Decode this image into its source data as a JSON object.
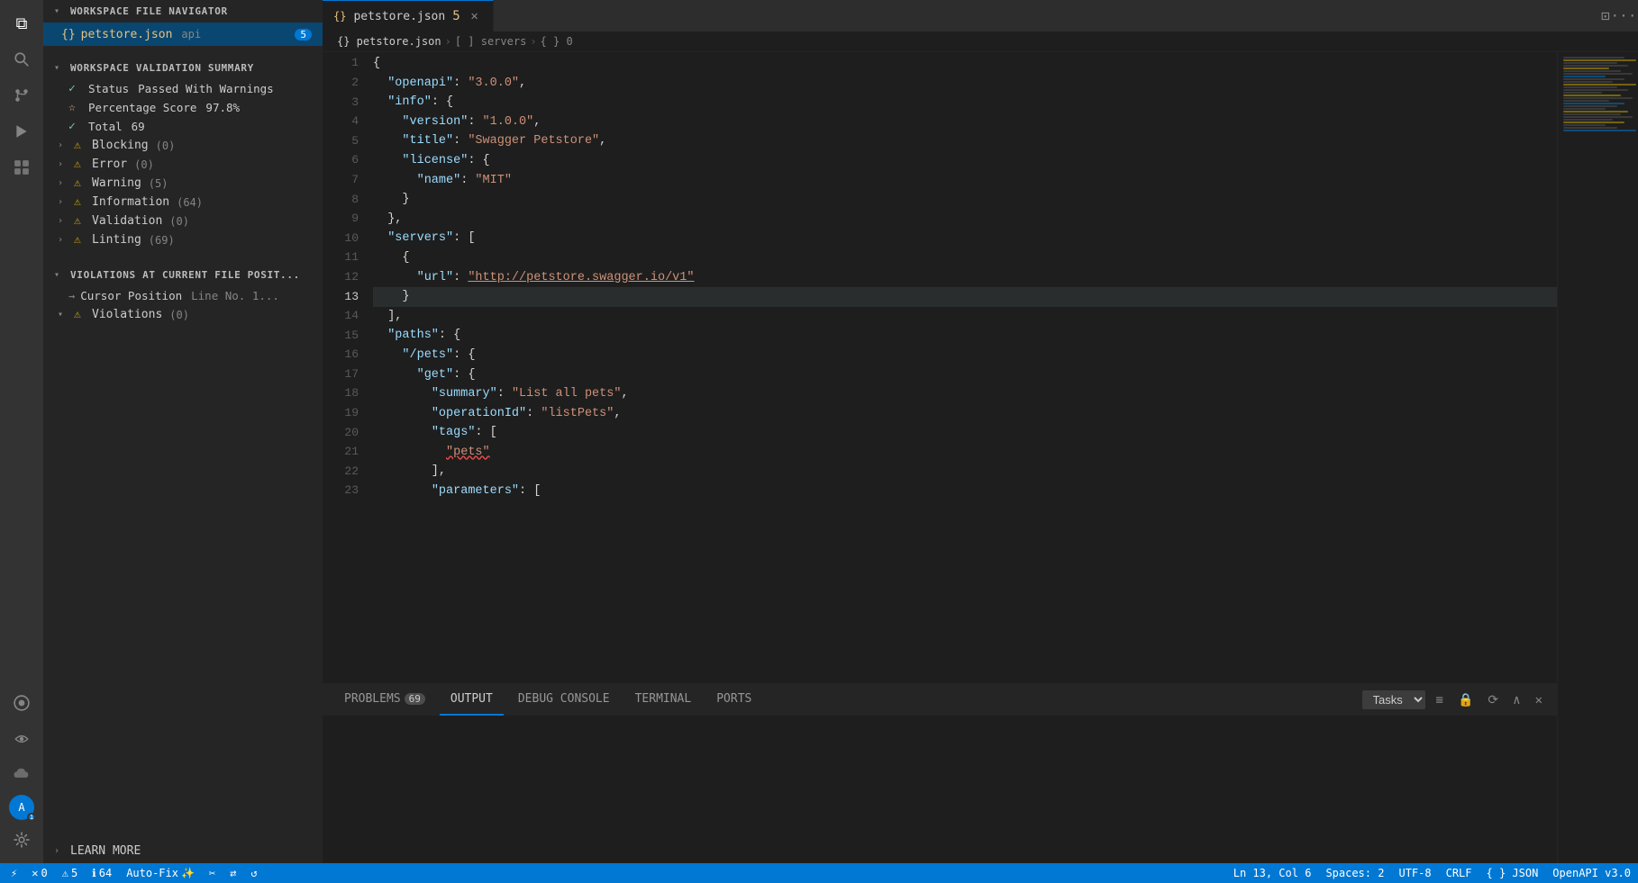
{
  "activityBar": {
    "icons": [
      {
        "name": "files-icon",
        "symbol": "⧉",
        "active": true
      },
      {
        "name": "search-icon",
        "symbol": "🔍"
      },
      {
        "name": "source-control-icon",
        "symbol": "⑂"
      },
      {
        "name": "run-debug-icon",
        "symbol": "▷"
      },
      {
        "name": "extensions-icon",
        "symbol": "⧉"
      },
      {
        "name": "github-icon",
        "symbol": "●"
      },
      {
        "name": "remote-icon",
        "symbol": "☁"
      },
      {
        "name": "cloud-icon",
        "symbol": "☁"
      }
    ]
  },
  "sidebar": {
    "workspaceNavigator": {
      "label": "WORKSPACE FILE NAVIGATOR",
      "file": {
        "icon": "{}",
        "name": "petstore.json",
        "desc": "api",
        "badge": "5"
      }
    },
    "validationSummary": {
      "label": "WORKSPACE VALIDATION SUMMARY",
      "items": [
        {
          "type": "status",
          "icon": "✓",
          "label": "Status",
          "value": "Passed With Warnings"
        },
        {
          "type": "star",
          "icon": "☆",
          "label": "Percentage Score",
          "value": "97.8%"
        },
        {
          "type": "check",
          "icon": "✓",
          "label": "Total",
          "value": "69"
        }
      ],
      "violations": [
        {
          "label": "Blocking",
          "count": "(0)"
        },
        {
          "label": "Error",
          "count": "(0)"
        },
        {
          "label": "Warning",
          "count": "(5)"
        },
        {
          "label": "Information",
          "count": "(64)"
        },
        {
          "label": "Validation",
          "count": "(0)"
        },
        {
          "label": "Linting",
          "count": "(69)"
        }
      ]
    },
    "violationsSection": {
      "label": "VIOLATIONS AT CURRENT FILE POSIT...",
      "cursorPosition": {
        "label": "Cursor Position",
        "value": "Line No. 1..."
      },
      "violations": {
        "label": "Violations",
        "count": "(0)"
      }
    },
    "learnMore": {
      "label": "LEARN MORE"
    }
  },
  "editor": {
    "tab": {
      "icon": "{}",
      "name": "petstore.json",
      "modified": "5",
      "closable": true
    },
    "breadcrumb": {
      "file": "petstore.json",
      "path1": "[ ] servers",
      "path2": "{ } 0"
    },
    "lines": [
      {
        "num": 1,
        "content": "{"
      },
      {
        "num": 2,
        "content": "  \"openapi\": \"3.0.0\","
      },
      {
        "num": 3,
        "content": "  \"info\": {"
      },
      {
        "num": 4,
        "content": "    \"version\": \"1.0.0\","
      },
      {
        "num": 5,
        "content": "    \"title\": \"Swagger Petstore\","
      },
      {
        "num": 6,
        "content": "    \"license\": {"
      },
      {
        "num": 7,
        "content": "      \"name\": \"MIT\""
      },
      {
        "num": 8,
        "content": "    }"
      },
      {
        "num": 9,
        "content": "  },"
      },
      {
        "num": 10,
        "content": "  \"servers\": ["
      },
      {
        "num": 11,
        "content": "    {"
      },
      {
        "num": 12,
        "content": "      \"url\": \"http://petstore.swagger.io/v1\""
      },
      {
        "num": 13,
        "content": "    }"
      },
      {
        "num": 14,
        "content": "  ],"
      },
      {
        "num": 15,
        "content": "  \"paths\": {"
      },
      {
        "num": 16,
        "content": "    \"/pets\": {"
      },
      {
        "num": 17,
        "content": "      \"get\": {"
      },
      {
        "num": 18,
        "content": "        \"summary\": \"List all pets\","
      },
      {
        "num": 19,
        "content": "        \"operationId\": \"listPets\","
      },
      {
        "num": 20,
        "content": "        \"tags\": ["
      },
      {
        "num": 21,
        "content": "          \"pets\""
      },
      {
        "num": 22,
        "content": "        ],"
      },
      {
        "num": 23,
        "content": "        \"parameters\": ["
      }
    ],
    "activeLine": 13,
    "cursorInfo": "Ln 13, Col 6",
    "spacesInfo": "Spaces: 2",
    "encodingInfo": "UTF-8",
    "lineEndingInfo": "CRLF",
    "languageInfo": "JSON",
    "apiInfo": "OpenAPI v3.0"
  },
  "panel": {
    "tabs": [
      {
        "label": "PROBLEMS",
        "badge": "69"
      },
      {
        "label": "OUTPUT",
        "active": true
      },
      {
        "label": "DEBUG CONSOLE"
      },
      {
        "label": "TERMINAL"
      },
      {
        "label": "PORTS"
      }
    ],
    "taskSelector": "Tasks",
    "controls": [
      "list-icon",
      "lock-icon",
      "refresh-icon",
      "chevron-up-icon",
      "close-icon"
    ]
  },
  "statusBar": {
    "left": [
      {
        "name": "git-branch",
        "text": "⚡"
      },
      {
        "name": "errors",
        "text": "✕ 0"
      },
      {
        "name": "warnings",
        "text": "⚠ 5"
      },
      {
        "name": "info",
        "text": "ℹ 64"
      },
      {
        "name": "autofix",
        "text": "Auto-Fix ✨"
      },
      {
        "name": "tools1",
        "text": "✂"
      },
      {
        "name": "tools2",
        "text": "⇄"
      },
      {
        "name": "tools3",
        "text": "↺"
      }
    ],
    "right": [
      {
        "name": "cursor-pos",
        "text": "Ln 13, Col 6"
      },
      {
        "name": "spaces",
        "text": "Spaces: 2"
      },
      {
        "name": "encoding",
        "text": "UTF-8"
      },
      {
        "name": "line-ending",
        "text": "CRLF"
      },
      {
        "name": "language",
        "text": "{ } JSON"
      },
      {
        "name": "api-version",
        "text": "OpenAPI v3.0"
      }
    ]
  }
}
